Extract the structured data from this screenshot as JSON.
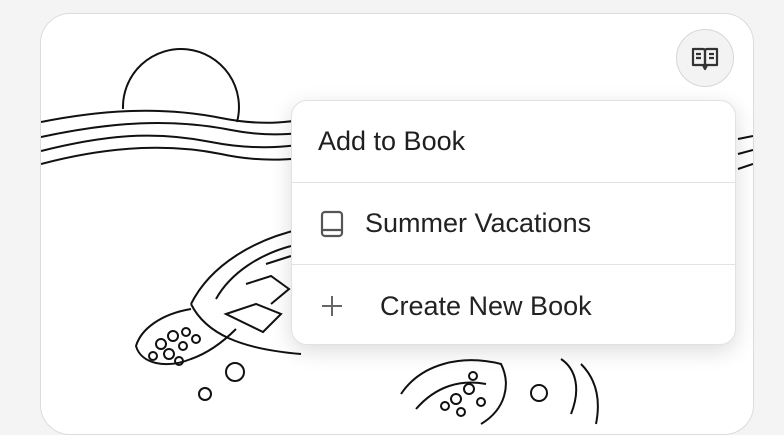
{
  "book_button": {
    "icon": "open-book-icon"
  },
  "menu": {
    "title": "Add to Book",
    "items": [
      {
        "label": "Summer Vacations",
        "icon": "book-icon"
      },
      {
        "label": "Create New Book",
        "icon": "plus-icon"
      }
    ]
  },
  "colors": {
    "card_background": "#ffffff",
    "page_background": "#f4f4f4",
    "line_art": "#111111",
    "menu_border": "#e2e2e2"
  }
}
